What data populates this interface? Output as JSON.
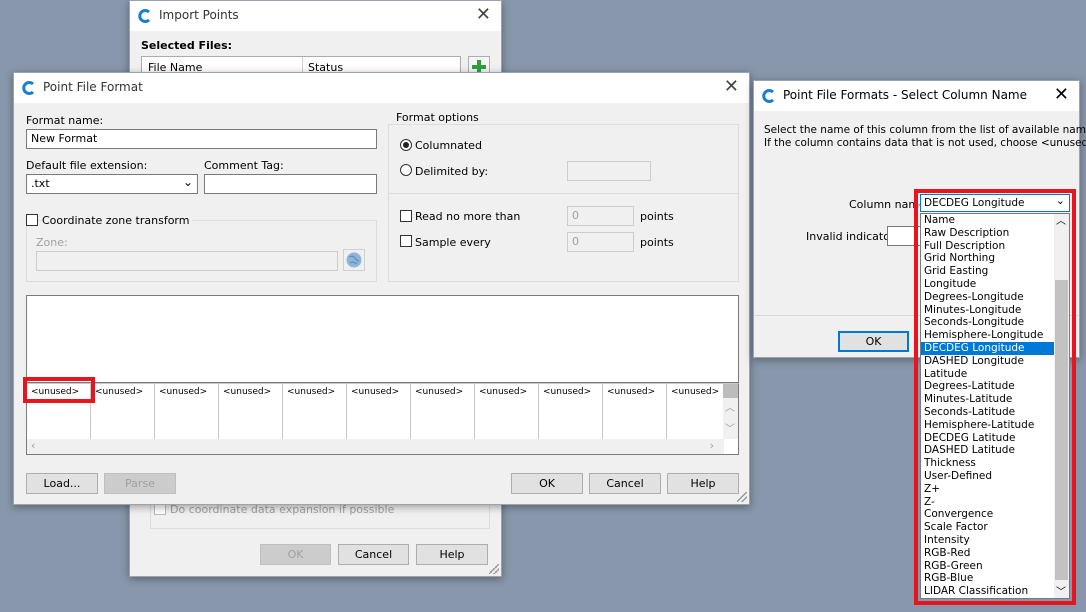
{
  "import_points": {
    "title": "Import Points",
    "selected_files_label": "Selected Files:",
    "col_file_name": "File Name",
    "col_status": "Status",
    "expansion_label": "Do coordinate data expansion if possible",
    "ok": "OK",
    "cancel": "Cancel",
    "help": "Help"
  },
  "point_file_format": {
    "title": "Point File Format",
    "format_name_label": "Format name:",
    "format_name_value": "New Format",
    "default_ext_label": "Default file extension:",
    "default_ext_value": ".txt",
    "comment_tag_label": "Comment Tag:",
    "comment_tag_value": "",
    "coord_zone_label": "Coordinate zone transform",
    "zone_label": "Zone:",
    "format_options_label": "Format options",
    "columnated_label": "Columnated",
    "delimited_label": "Delimited by:",
    "read_no_more_label": "Read no more than",
    "read_no_more_value": "0",
    "sample_every_label": "Sample every",
    "sample_every_value": "0",
    "points_unit": "points",
    "columns": [
      "<unused>",
      "<unused>",
      "<unused>",
      "<unused>",
      "<unused>",
      "<unused>",
      "<unused>",
      "<unused>",
      "<unused>",
      "<unused>",
      "<unused>"
    ],
    "load": "Load...",
    "parse": "Parse",
    "ok": "OK",
    "cancel": "Cancel",
    "help": "Help"
  },
  "select_column": {
    "title": "Point File Formats - Select Column Name",
    "instruction_1": "Select the name of this column from the list of available names.",
    "instruction_2": "If the column contains data that is not used, choose <unused>.",
    "column_name_label": "Column name:",
    "column_name_value": "DECDEG Longitude",
    "invalid_indicator_label": "Invalid indicator:",
    "ok": "OK",
    "options": [
      "Name",
      "Raw Description",
      "Full Description",
      "Grid Northing",
      "Grid Easting",
      "Longitude",
      "Degrees-Longitude",
      "Minutes-Longitude",
      "Seconds-Longitude",
      "Hemisphere-Longitude",
      "DECDEG Longitude",
      "DASHED Longitude",
      "Latitude",
      "Degrees-Latitude",
      "Minutes-Latitude",
      "Seconds-Latitude",
      "Hemisphere-Latitude",
      "DECDEG Latitude",
      "DASHED Latitude",
      "Thickness",
      "User-Defined",
      "Z+",
      "Z-",
      "Convergence",
      "Scale Factor",
      "Intensity",
      "RGB-Red",
      "RGB-Green",
      "RGB-Blue",
      "LIDAR Classification"
    ],
    "selected_option": "DECDEG Longitude"
  },
  "colors": {
    "highlight": "#e8141e",
    "selection": "#0078d7",
    "desktop": "#8897ab"
  }
}
